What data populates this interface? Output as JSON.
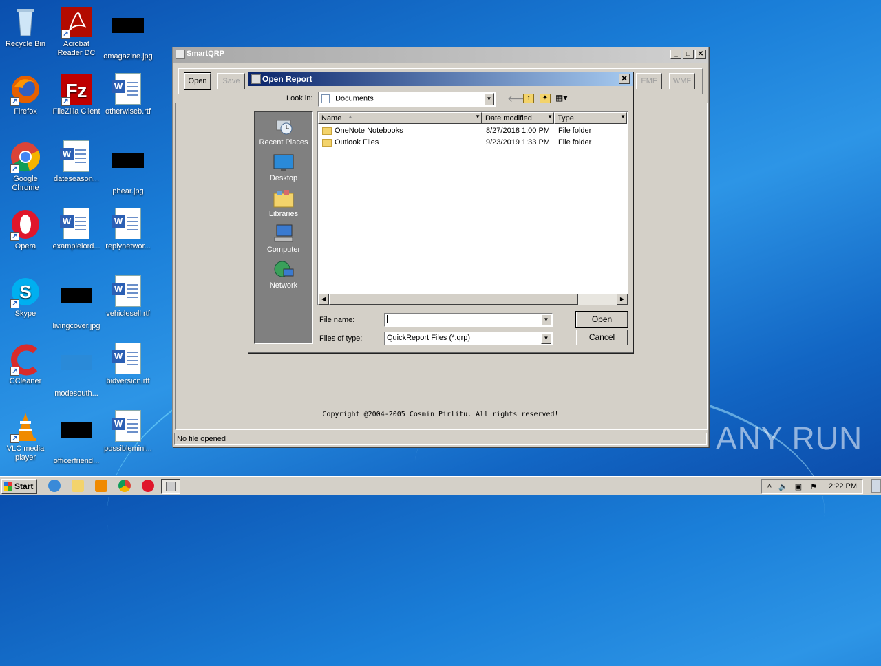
{
  "desktop": {
    "icons": [
      {
        "label": "Recycle Bin"
      },
      {
        "label": "Acrobat Reader DC"
      },
      {
        "label": "omagazine.jpg"
      },
      {
        "label": "Firefox"
      },
      {
        "label": "FileZilla Client"
      },
      {
        "label": "otherwiseb.rtf"
      },
      {
        "label": "Google Chrome"
      },
      {
        "label": "dateseason..."
      },
      {
        "label": "phear.jpg"
      },
      {
        "label": "Opera"
      },
      {
        "label": "examplelord..."
      },
      {
        "label": "replynetwor..."
      },
      {
        "label": "Skype"
      },
      {
        "label": "livingcover.jpg"
      },
      {
        "label": "vehiclesell.rtf"
      },
      {
        "label": "CCleaner"
      },
      {
        "label": "modesouth..."
      },
      {
        "label": "bidversion.rtf"
      },
      {
        "label": "VLC media player"
      },
      {
        "label": "officerfriend..."
      },
      {
        "label": "possiblemini..."
      }
    ]
  },
  "smartqrp": {
    "title": "SmartQRP",
    "toolbar": {
      "open": "Open",
      "save": "Save",
      "emf": "EMF",
      "wmf": "WMF"
    },
    "copyright": "Copyright @2004-2005 Cosmin Pirlitu. All rights reserved!",
    "status": "No file opened"
  },
  "dialog": {
    "title": "Open Report",
    "look_in_label": "Look in:",
    "look_in_value": "Documents",
    "places": [
      "Recent Places",
      "Desktop",
      "Libraries",
      "Computer",
      "Network"
    ],
    "columns": {
      "name": "Name",
      "date": "Date modified",
      "type": "Type"
    },
    "files": [
      {
        "name": "OneNote Notebooks",
        "date": "8/27/2018 1:00 PM",
        "type": "File folder"
      },
      {
        "name": "Outlook Files",
        "date": "9/23/2019 1:33 PM",
        "type": "File folder"
      }
    ],
    "file_name_label": "File name:",
    "file_name_value": "",
    "file_type_label": "Files of type:",
    "file_type_value": "QuickReport Files (*.qrp)",
    "open_button": "Open",
    "cancel_button": "Cancel"
  },
  "taskbar": {
    "start": "Start",
    "clock": "2:22 PM"
  },
  "watermark": "ANY RUN"
}
